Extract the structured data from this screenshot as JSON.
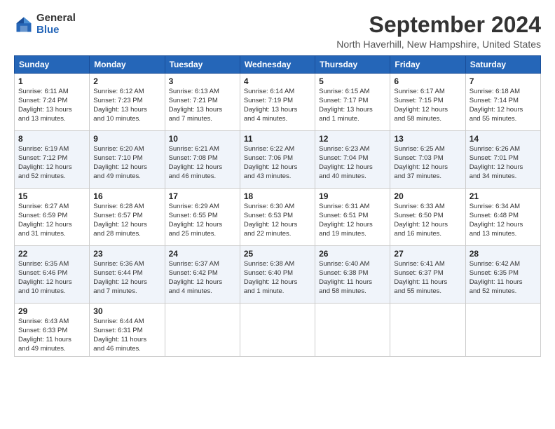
{
  "logo": {
    "general": "General",
    "blue": "Blue"
  },
  "title": "September 2024",
  "location": "North Haverhill, New Hampshire, United States",
  "headers": [
    "Sunday",
    "Monday",
    "Tuesday",
    "Wednesday",
    "Thursday",
    "Friday",
    "Saturday"
  ],
  "weeks": [
    [
      {
        "day": "1",
        "info": "Sunrise: 6:11 AM\nSunset: 7:24 PM\nDaylight: 13 hours\nand 13 minutes."
      },
      {
        "day": "2",
        "info": "Sunrise: 6:12 AM\nSunset: 7:23 PM\nDaylight: 13 hours\nand 10 minutes."
      },
      {
        "day": "3",
        "info": "Sunrise: 6:13 AM\nSunset: 7:21 PM\nDaylight: 13 hours\nand 7 minutes."
      },
      {
        "day": "4",
        "info": "Sunrise: 6:14 AM\nSunset: 7:19 PM\nDaylight: 13 hours\nand 4 minutes."
      },
      {
        "day": "5",
        "info": "Sunrise: 6:15 AM\nSunset: 7:17 PM\nDaylight: 13 hours\nand 1 minute."
      },
      {
        "day": "6",
        "info": "Sunrise: 6:17 AM\nSunset: 7:15 PM\nDaylight: 12 hours\nand 58 minutes."
      },
      {
        "day": "7",
        "info": "Sunrise: 6:18 AM\nSunset: 7:14 PM\nDaylight: 12 hours\nand 55 minutes."
      }
    ],
    [
      {
        "day": "8",
        "info": "Sunrise: 6:19 AM\nSunset: 7:12 PM\nDaylight: 12 hours\nand 52 minutes."
      },
      {
        "day": "9",
        "info": "Sunrise: 6:20 AM\nSunset: 7:10 PM\nDaylight: 12 hours\nand 49 minutes."
      },
      {
        "day": "10",
        "info": "Sunrise: 6:21 AM\nSunset: 7:08 PM\nDaylight: 12 hours\nand 46 minutes."
      },
      {
        "day": "11",
        "info": "Sunrise: 6:22 AM\nSunset: 7:06 PM\nDaylight: 12 hours\nand 43 minutes."
      },
      {
        "day": "12",
        "info": "Sunrise: 6:23 AM\nSunset: 7:04 PM\nDaylight: 12 hours\nand 40 minutes."
      },
      {
        "day": "13",
        "info": "Sunrise: 6:25 AM\nSunset: 7:03 PM\nDaylight: 12 hours\nand 37 minutes."
      },
      {
        "day": "14",
        "info": "Sunrise: 6:26 AM\nSunset: 7:01 PM\nDaylight: 12 hours\nand 34 minutes."
      }
    ],
    [
      {
        "day": "15",
        "info": "Sunrise: 6:27 AM\nSunset: 6:59 PM\nDaylight: 12 hours\nand 31 minutes."
      },
      {
        "day": "16",
        "info": "Sunrise: 6:28 AM\nSunset: 6:57 PM\nDaylight: 12 hours\nand 28 minutes."
      },
      {
        "day": "17",
        "info": "Sunrise: 6:29 AM\nSunset: 6:55 PM\nDaylight: 12 hours\nand 25 minutes."
      },
      {
        "day": "18",
        "info": "Sunrise: 6:30 AM\nSunset: 6:53 PM\nDaylight: 12 hours\nand 22 minutes."
      },
      {
        "day": "19",
        "info": "Sunrise: 6:31 AM\nSunset: 6:51 PM\nDaylight: 12 hours\nand 19 minutes."
      },
      {
        "day": "20",
        "info": "Sunrise: 6:33 AM\nSunset: 6:50 PM\nDaylight: 12 hours\nand 16 minutes."
      },
      {
        "day": "21",
        "info": "Sunrise: 6:34 AM\nSunset: 6:48 PM\nDaylight: 12 hours\nand 13 minutes."
      }
    ],
    [
      {
        "day": "22",
        "info": "Sunrise: 6:35 AM\nSunset: 6:46 PM\nDaylight: 12 hours\nand 10 minutes."
      },
      {
        "day": "23",
        "info": "Sunrise: 6:36 AM\nSunset: 6:44 PM\nDaylight: 12 hours\nand 7 minutes."
      },
      {
        "day": "24",
        "info": "Sunrise: 6:37 AM\nSunset: 6:42 PM\nDaylight: 12 hours\nand 4 minutes."
      },
      {
        "day": "25",
        "info": "Sunrise: 6:38 AM\nSunset: 6:40 PM\nDaylight: 12 hours\nand 1 minute."
      },
      {
        "day": "26",
        "info": "Sunrise: 6:40 AM\nSunset: 6:38 PM\nDaylight: 11 hours\nand 58 minutes."
      },
      {
        "day": "27",
        "info": "Sunrise: 6:41 AM\nSunset: 6:37 PM\nDaylight: 11 hours\nand 55 minutes."
      },
      {
        "day": "28",
        "info": "Sunrise: 6:42 AM\nSunset: 6:35 PM\nDaylight: 11 hours\nand 52 minutes."
      }
    ],
    [
      {
        "day": "29",
        "info": "Sunrise: 6:43 AM\nSunset: 6:33 PM\nDaylight: 11 hours\nand 49 minutes."
      },
      {
        "day": "30",
        "info": "Sunrise: 6:44 AM\nSunset: 6:31 PM\nDaylight: 11 hours\nand 46 minutes."
      },
      {
        "day": "",
        "info": ""
      },
      {
        "day": "",
        "info": ""
      },
      {
        "day": "",
        "info": ""
      },
      {
        "day": "",
        "info": ""
      },
      {
        "day": "",
        "info": ""
      }
    ]
  ]
}
